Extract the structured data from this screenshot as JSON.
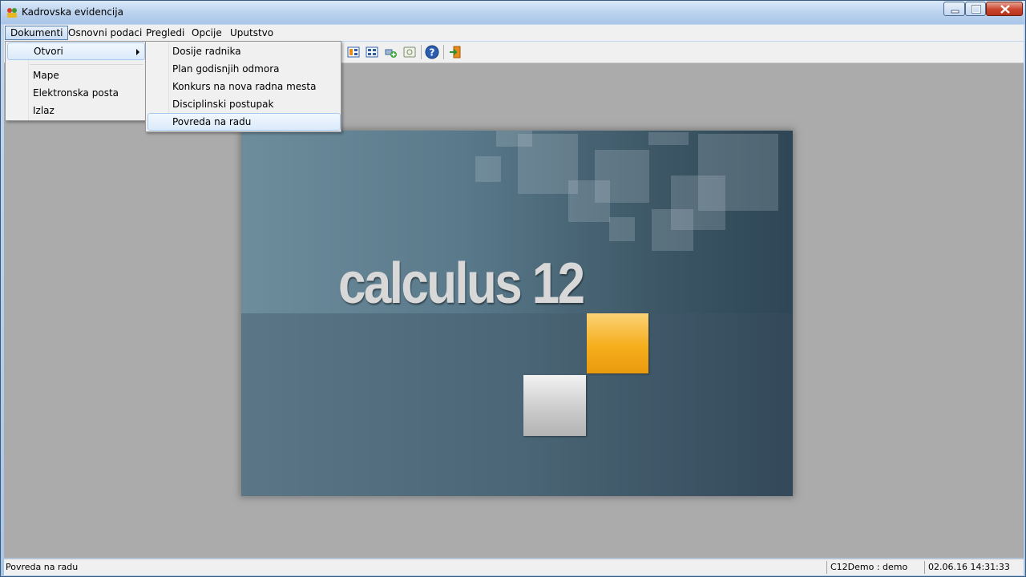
{
  "window": {
    "title": "Kadrovska evidencija"
  },
  "menubar": {
    "items": [
      {
        "label": "Dokumenti"
      },
      {
        "label": "Osnovni podaci"
      },
      {
        "label": "Pregledi"
      },
      {
        "label": "Opcije"
      },
      {
        "label": "Uputstvo"
      }
    ]
  },
  "dokumenti_menu": {
    "items": [
      {
        "label": "Otvori"
      },
      {
        "label": "Mape"
      },
      {
        "label": "Elektronska posta"
      },
      {
        "label": "Izlaz"
      }
    ]
  },
  "otvori_submenu": {
    "items": [
      {
        "label": "Dosije radnika"
      },
      {
        "label": "Plan godisnjih odmora"
      },
      {
        "label": "Konkurs na nova radna mesta"
      },
      {
        "label": "Disciplinski postupak"
      },
      {
        "label": "Povreda na radu"
      }
    ]
  },
  "splash": {
    "logo_text": "calculus 12"
  },
  "statusbar": {
    "message": "Povreda na radu",
    "user": "C12Demo : demo",
    "datetime": "02.06.16 14:31:33"
  },
  "colors": {
    "accent_orange": "#f6ae1c",
    "title_bar": "#bcd3ee",
    "client_bg": "#ababab"
  }
}
